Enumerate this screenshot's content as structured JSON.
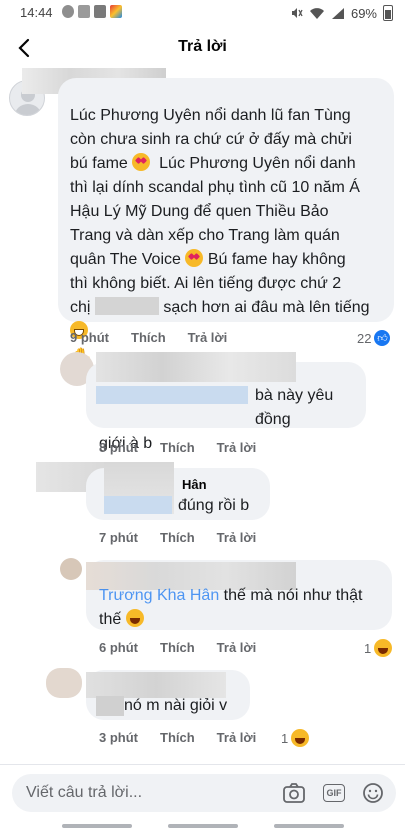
{
  "status_bar": {
    "time": "14:44",
    "battery": "69%"
  },
  "header": {
    "title": "Trả lời"
  },
  "comments": [
    {
      "text_lines": [
        "Lúc Phương Uyên nổi danh lũ fan Tùng",
        "còn chưa sinh ra chứ cứ ở đấy mà chửi",
        "bú fame",
        "Lúc Phương Uyên nổi danh",
        "thì lại dính scandal phụ tình cũ 10 năm Á",
        "Hậu Lý Mỹ Dung để quen Thiều Bảo",
        "Trang và dàn xếp cho Trang làm quán",
        "quân The Voice",
        "Bú fame hay không",
        "thì không biết. Ai lên tiếng được chứ 2",
        "chị",
        "sạch hơn ai đâu mà lên tiếng"
      ],
      "time": "9 phút",
      "like": "Thích",
      "reply": "Trả lời",
      "reaction_count": "22",
      "reaction_icon": "like-icon"
    },
    {
      "text_lines": [
        "bà này yêu đồng",
        "giới à b"
      ],
      "time": "8 phút",
      "like": "Thích",
      "reply": "Trả lời"
    },
    {
      "author_fragment": "Hân",
      "text": "đúng rồi b",
      "time": "7 phút",
      "like": "Thích",
      "reply": "Trả lời"
    },
    {
      "mention": "Trương Kha Hân",
      "text_lines": [
        "thế mà nói như thật",
        "thế"
      ],
      "time": "6 phút",
      "like": "Thích",
      "reply": "Trả lời",
      "reaction_count": "1",
      "reaction_icon": "laugh-emoji"
    },
    {
      "text": "nó m nài giỏi v",
      "time": "3 phút",
      "like": "Thích",
      "reply": "Trả lời",
      "reaction_count": "1",
      "reaction_icon": "laugh-emoji"
    }
  ],
  "composer": {
    "placeholder": "Viết câu trả lời...",
    "icons": [
      "camera-icon",
      "gif-icon",
      "emoji-icon"
    ]
  },
  "colors": {
    "bubble": "#f0f2f5",
    "link": "#1877f2",
    "meta": "#65676b"
  }
}
